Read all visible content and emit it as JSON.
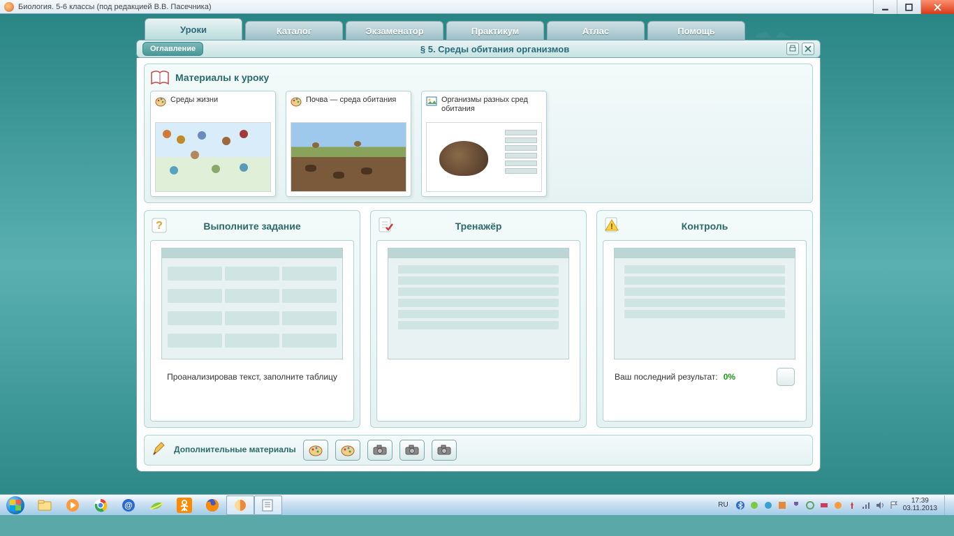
{
  "window": {
    "title": "Биология. 5-6 классы (под редакцией В.В. Пасечника)"
  },
  "tabs": {
    "items": [
      "Уроки",
      "Каталог",
      "Экзаменатор",
      "Практикум",
      "Атлас",
      "Помощь"
    ],
    "active_index": 0
  },
  "crumb": {
    "toc_label": "Оглавление",
    "title": "§ 5. Среды обитания организмов"
  },
  "materials": {
    "heading": "Материалы к уроку",
    "cards": [
      {
        "title": "Среды жизни"
      },
      {
        "title": "Почва — среда обитания"
      },
      {
        "title": "Организмы разных сред обитания"
      }
    ]
  },
  "tasks": {
    "assignment": {
      "heading": "Выполните задание",
      "caption": "Проанализировав текст, заполните таблицу"
    },
    "trainer": {
      "heading": "Тренажёр"
    },
    "control": {
      "heading": "Контроль",
      "result_label": "Ваш последний результат:",
      "result_value": "0%"
    }
  },
  "extras": {
    "label": "Дополнительные материалы"
  },
  "taskbar": {
    "lang": "RU",
    "time": "17:39",
    "date": "03.11.2013"
  }
}
